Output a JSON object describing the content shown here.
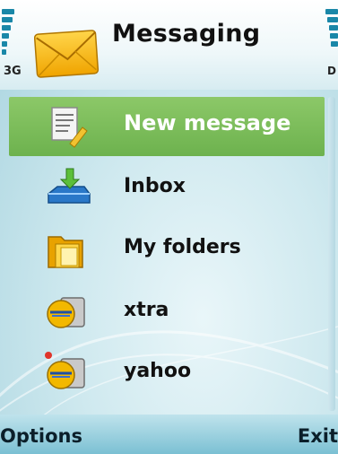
{
  "status": {
    "network": "3G",
    "battery_marker": "D"
  },
  "title": {
    "app_name": "Messaging",
    "icon": "envelope-icon"
  },
  "menu": {
    "items": [
      {
        "label": "New message",
        "icon": "new-message-icon",
        "selected": true
      },
      {
        "label": "Inbox",
        "icon": "inbox-icon",
        "selected": false
      },
      {
        "label": "My folders",
        "icon": "folder-icon",
        "selected": false
      },
      {
        "label": "xtra",
        "icon": "mailbox-icon",
        "selected": false
      },
      {
        "label": "yahoo",
        "icon": "mailbox-icon",
        "selected": false
      }
    ]
  },
  "softkeys": {
    "left": "Options",
    "right": "Exit"
  },
  "colors": {
    "highlight": "#7cbd5a",
    "accent": "#1a87a8"
  }
}
